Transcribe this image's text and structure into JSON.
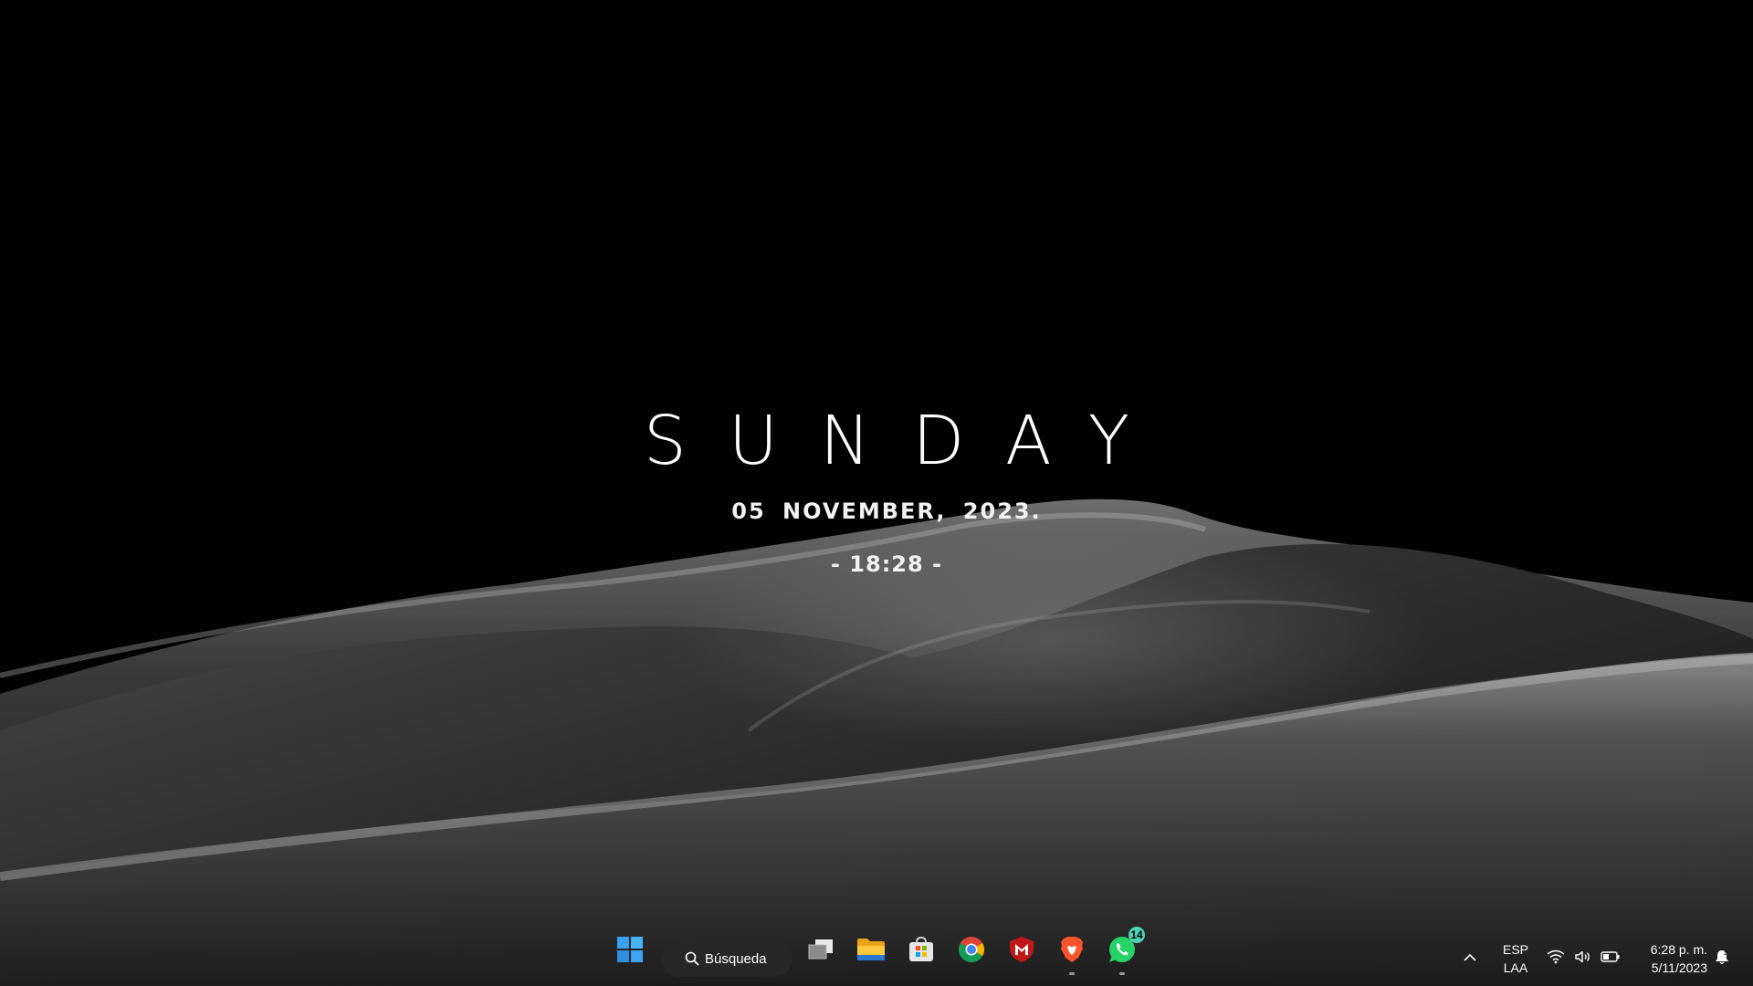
{
  "widget": {
    "weekday": "SUNDAY",
    "date": "05 NOVEMBER, 2023.",
    "time": "- 18:28 -"
  },
  "taskbar": {
    "search_label": "Búsqueda",
    "apps": [
      {
        "name": "Start",
        "icon": "windows-start-icon"
      },
      {
        "name": "Task View",
        "icon": "task-view-icon"
      },
      {
        "name": "File Explorer",
        "icon": "folder-icon"
      },
      {
        "name": "Microsoft Store",
        "icon": "store-icon"
      },
      {
        "name": "Chrome",
        "icon": "chrome-icon"
      },
      {
        "name": "McAfee",
        "icon": "mcafee-icon"
      },
      {
        "name": "Brave",
        "icon": "brave-icon",
        "running": true
      },
      {
        "name": "WhatsApp",
        "icon": "whatsapp-icon",
        "running": true,
        "badge": "14"
      }
    ],
    "whatsapp_badge": "14"
  },
  "tray": {
    "language_line1": "ESP",
    "language_line2": "LAA",
    "time": "6:28 p. m.",
    "date": "5/11/2023"
  },
  "colors": {
    "accent": "#4fd1b5",
    "background": "#000000"
  }
}
